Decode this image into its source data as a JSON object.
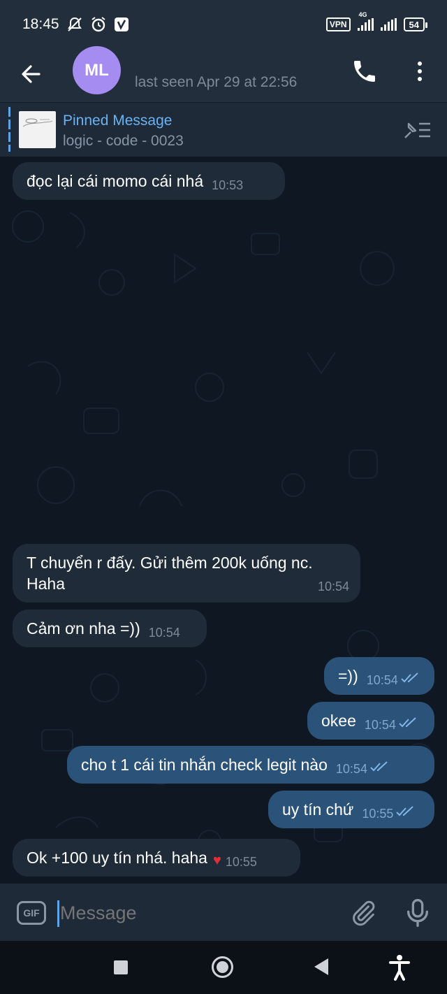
{
  "status_bar": {
    "time": "18:45",
    "vpn": "VPN",
    "network": "4G",
    "battery": "54"
  },
  "header": {
    "avatar_initials": "ML",
    "avatar_color": "#a48cf0",
    "last_seen": "last seen Apr 29 at 22:56"
  },
  "pinned": {
    "title": "Pinned Message",
    "subtitle": "logic - code - 0023"
  },
  "messages": [
    {
      "dir": "in",
      "text": "đọc lại cái momo cái nhá",
      "time": "10:53"
    },
    {
      "dir": "in",
      "text": "T chuyển r đấy. Gửi thêm 200k uống nc. Haha",
      "time": "10:54"
    },
    {
      "dir": "in",
      "text": "Cảm ơn nha =))",
      "time": "10:54"
    },
    {
      "dir": "out",
      "text": "=))",
      "time": "10:54"
    },
    {
      "dir": "out",
      "text": "okee",
      "time": "10:54"
    },
    {
      "dir": "out",
      "text": "cho t 1 cái tin nhắn check legit nào",
      "time": "10:54"
    },
    {
      "dir": "out",
      "text": "uy tín chứ",
      "time": "10:55"
    },
    {
      "dir": "in",
      "text": "Ok +100 uy tín nhá. haha",
      "time": "10:55",
      "reaction": "♥"
    }
  ],
  "composer": {
    "gif_label": "GIF",
    "placeholder": "Message"
  },
  "colors": {
    "accent": "#6ab2f2",
    "incoming_bubble": "#1f2b39",
    "outgoing_bubble": "#2b5278",
    "reaction": "#e52d3a"
  }
}
